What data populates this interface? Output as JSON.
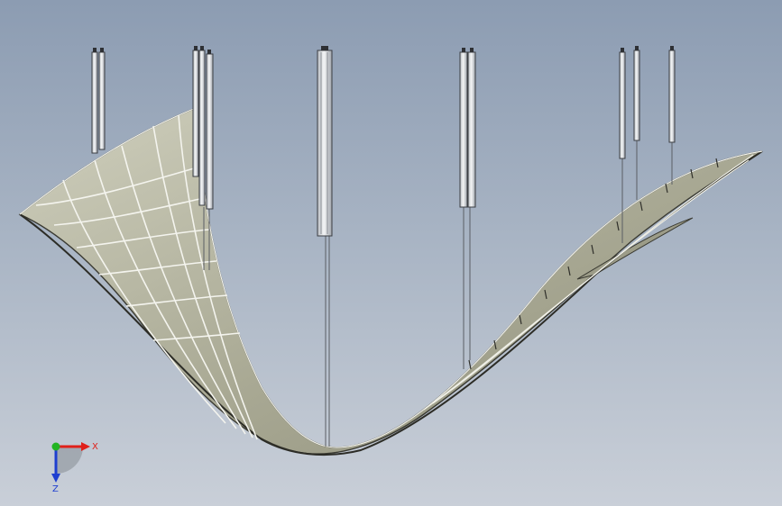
{
  "triad": {
    "x_label": "X",
    "z_label": "Z",
    "colors": {
      "x_axis": "#e0201a",
      "y_axis": "#22b422",
      "z_axis": "#1f3fd0"
    }
  },
  "colors": {
    "background_top": "#8c9cb2",
    "background_bottom": "#c9cfd8",
    "surface": "#b9b9a3",
    "surface_edge": "#3a3a32",
    "rod": "#d8dadc",
    "rod_edge": "#4a4a4a"
  }
}
